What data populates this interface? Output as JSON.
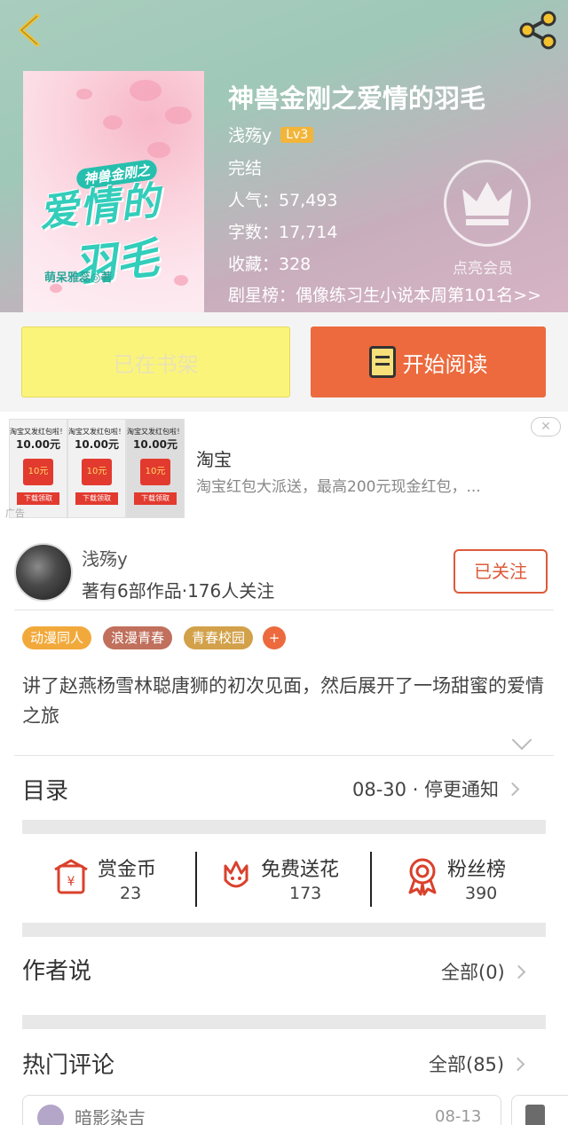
{
  "book": {
    "title": "神兽金刚之爱情的羽毛",
    "author": "浅殇y",
    "level": "Lv3",
    "status": "完结",
    "popularity": "人气：57,493",
    "word_count": "字数：17,714",
    "favorites": "收藏：328",
    "ranking": "剧星榜：偶像练习生小说本周第101名>>",
    "cover": {
      "small_title": "神兽金刚之",
      "big_title_1": "爱情的",
      "big_title_2": "羽毛",
      "author": "萌呆雅蕊◎著"
    }
  },
  "vip": {
    "label": "点亮会员"
  },
  "actions": {
    "shelf_label": "已在书架",
    "read_label": "开始阅读"
  },
  "ad": {
    "title": "淘宝",
    "description": "淘宝红包大派送，最高200元现金红包，...",
    "label": "广告",
    "close": "✕",
    "thumb_heading": "淘宝又发红包啦！",
    "thumb_amount": "10.00元",
    "thumb_envelope": "10元",
    "thumb_button": "下载领取"
  },
  "author_section": {
    "name": "浅殇y",
    "info": "著有6部作品·176人关注",
    "follow_label": "已关注"
  },
  "tags": [
    {
      "label": "动漫同人",
      "color": "#f2a93b"
    },
    {
      "label": "浪漫青春",
      "color": "#c0705c"
    },
    {
      "label": "青春校园",
      "color": "#d2a14a"
    },
    {
      "label": "+",
      "color": "#ec6a3d"
    }
  ],
  "description": "讲了赵燕杨雪林聪唐狮的初次见面，然后展开了一场甜蜜的爱情之旅",
  "catalog": {
    "title": "目录",
    "update": "08-30 · 停更通知"
  },
  "stats": [
    {
      "label": "赏金币",
      "value": "23",
      "icon": "red-envelope-icon"
    },
    {
      "label": "免费送花",
      "value": "173",
      "icon": "flower-icon"
    },
    {
      "label": "粉丝榜",
      "value": "390",
      "icon": "medal-icon"
    }
  ],
  "author_says": {
    "title": "作者说",
    "all": "全部(0)"
  },
  "hot_comments": {
    "title": "热门评论",
    "all": "全部(85)",
    "first": {
      "name": "暗影染吉",
      "date": "08-13"
    }
  },
  "colors": {
    "accent": "#ec6a3d",
    "shelf": "#fbf47b",
    "follow": "#dd5a3a"
  }
}
